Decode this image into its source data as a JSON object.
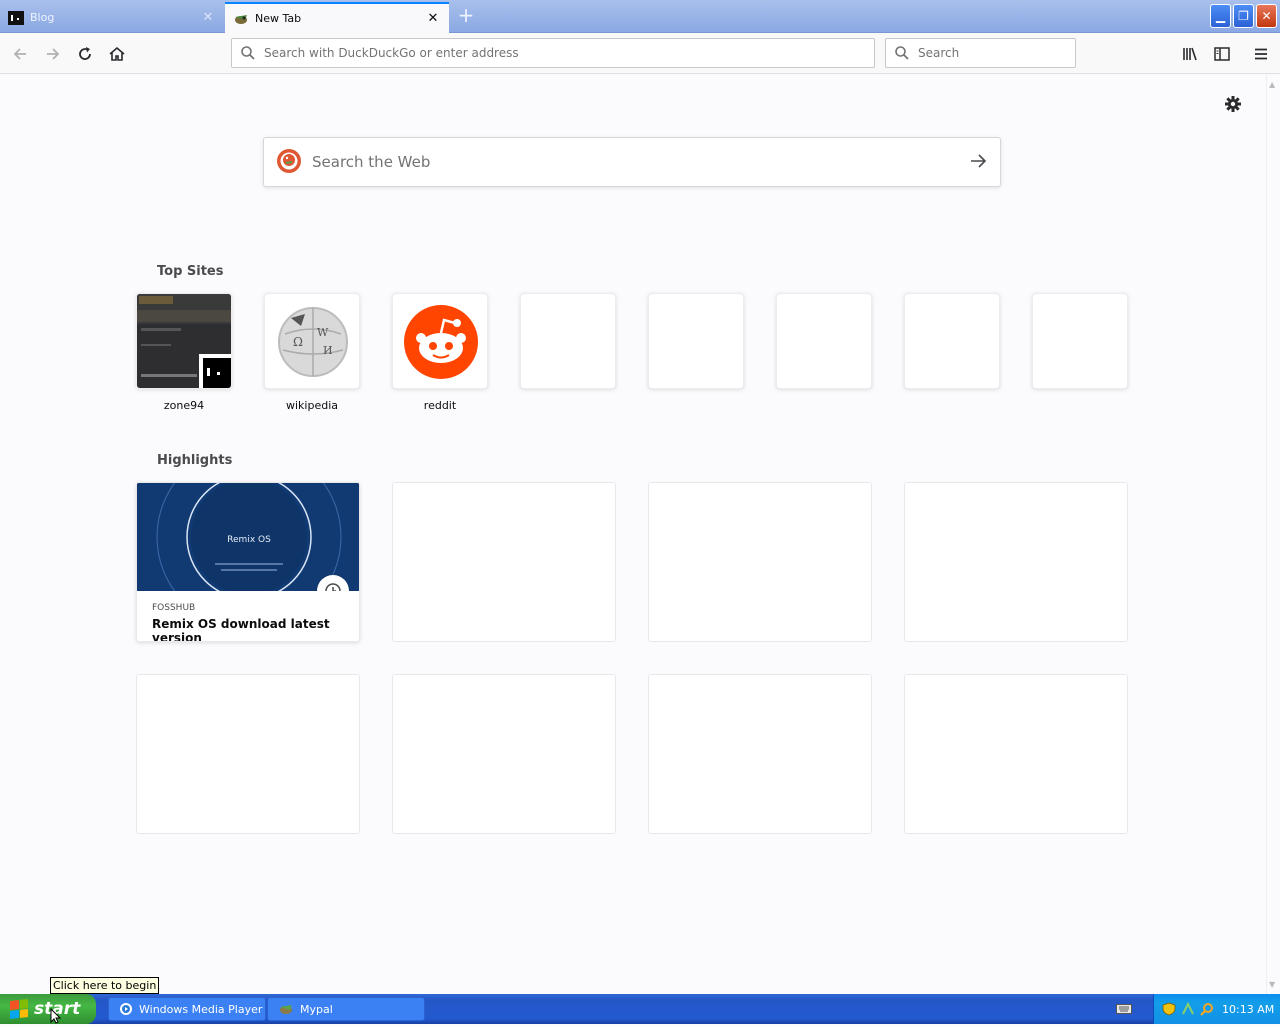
{
  "tabs": [
    {
      "title": "Blog",
      "icon": "terminal-favicon-icon",
      "active": false
    },
    {
      "title": "New Tab",
      "icon": "mypal-favicon-icon",
      "active": true
    }
  ],
  "toolbar": {
    "url_placeholder": "Search with DuckDuckGo or enter address",
    "search_placeholder": "Search"
  },
  "newtab": {
    "websearch_placeholder": "Search the Web",
    "top_sites_heading": "Top Sites",
    "top_sites": [
      {
        "label": "zone94"
      },
      {
        "label": "wikipedia"
      },
      {
        "label": "reddit"
      }
    ],
    "highlights_heading": "Highlights",
    "highlights": [
      {
        "host": "FOSSHUB",
        "title": "Remix OS download latest version",
        "thumb_text": "Remix OS"
      }
    ]
  },
  "taskbar": {
    "start_label": "start",
    "tooltip": "Click here to begin",
    "items": [
      {
        "label": "Windows Media Player",
        "icon": "media-player-icon"
      },
      {
        "label": "Mypal",
        "icon": "mypal-icon"
      }
    ],
    "clock": "10:13 AM"
  },
  "colors": {
    "accent": "#0a84ff",
    "reddit": "#ff4500",
    "taskbar": "#245ad1",
    "start_green": "#3c9a3c"
  }
}
